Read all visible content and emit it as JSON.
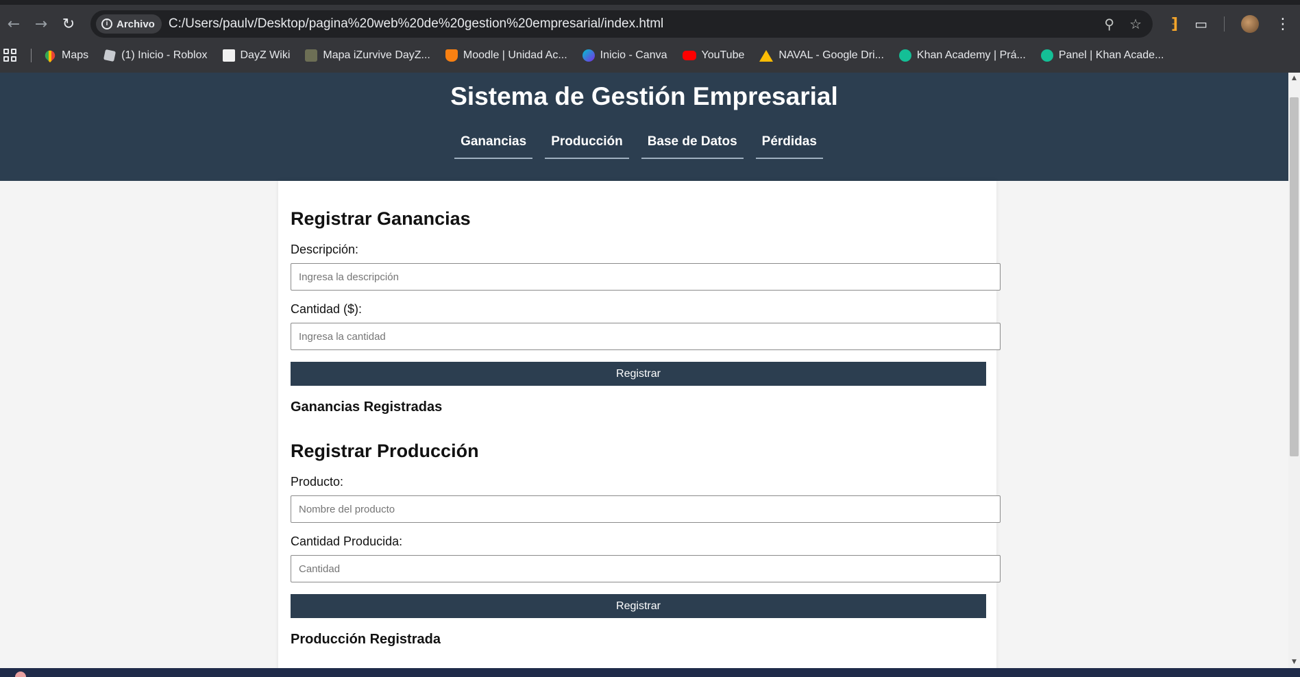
{
  "browser": {
    "site_chip": "Archivo",
    "url": "C:/Users/paulv/Desktop/pagina%20web%20de%20gestion%20empresarial/index.html",
    "bookmarks": [
      {
        "label": "Maps",
        "icon": "maps-icon"
      },
      {
        "label": "(1) Inicio - Roblox",
        "icon": "roblox-icon"
      },
      {
        "label": "DayZ Wiki",
        "icon": "dayz-icon"
      },
      {
        "label": "Mapa iZurvive DayZ...",
        "icon": "izurvive-icon"
      },
      {
        "label": "Moodle | Unidad Ac...",
        "icon": "moodle-icon"
      },
      {
        "label": "Inicio - Canva",
        "icon": "canva-icon"
      },
      {
        "label": "YouTube",
        "icon": "youtube-icon"
      },
      {
        "label": "NAVAL - Google Dri...",
        "icon": "drive-icon"
      },
      {
        "label": "Khan Academy | Prá...",
        "icon": "khan-icon"
      },
      {
        "label": "Panel | Khan Acade...",
        "icon": "khan-icon"
      }
    ]
  },
  "header": {
    "title": "Sistema de Gestión Empresarial",
    "nav": [
      "Ganancias",
      "Producción",
      "Base de Datos",
      "Pérdidas"
    ]
  },
  "ganancias": {
    "title": "Registrar Ganancias",
    "desc_label": "Descripción:",
    "desc_placeholder": "Ingresa la descripción",
    "amount_label": "Cantidad ($):",
    "amount_placeholder": "Ingresa la cantidad",
    "button": "Registrar",
    "list_title": "Ganancias Registradas"
  },
  "produccion": {
    "title": "Registrar Producción",
    "product_label": "Producto:",
    "product_placeholder": "Nombre del producto",
    "qty_label": "Cantidad Producida:",
    "qty_placeholder": "Cantidad",
    "button": "Registrar",
    "list_title": "Producción Registrada"
  },
  "colors": {
    "header_bg": "#2c3e50",
    "button_bg": "#2c3e50",
    "page_bg": "#f4f4f4",
    "chrome_bg": "#35363a"
  }
}
